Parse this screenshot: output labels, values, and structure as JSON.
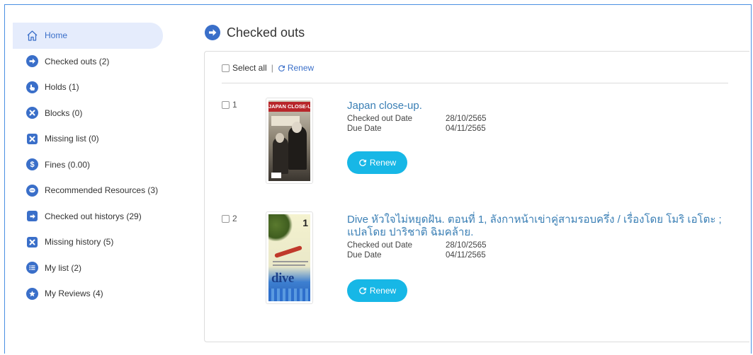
{
  "sidebar": {
    "items": [
      {
        "label": "Home",
        "icon": "home-icon"
      },
      {
        "label": "Checked outs (2)",
        "icon": "arrow-right-circle-icon"
      },
      {
        "label": "Holds (1)",
        "icon": "hand-pointer-icon"
      },
      {
        "label": "Blocks (0)",
        "icon": "block-x-circle-icon"
      },
      {
        "label": "Missing list (0)",
        "icon": "missing-x-square-icon"
      },
      {
        "label": "Fines (0.00)",
        "icon": "dollar-circle-icon"
      },
      {
        "label": "Recommended Resources (3)",
        "icon": "chat-bubble-icon"
      },
      {
        "label": "Checked out historys (29)",
        "icon": "sign-out-square-icon"
      },
      {
        "label": "Missing history (5)",
        "icon": "missing-history-x-square-icon"
      },
      {
        "label": "My list (2)",
        "icon": "list-icon"
      },
      {
        "label": "My Reviews (4)",
        "icon": "star-circle-icon"
      }
    ]
  },
  "page": {
    "title": "Checked outs",
    "select_all_label": "Select all",
    "separator": "|",
    "renew_link_label": "Renew"
  },
  "items": [
    {
      "index": "1",
      "title": "Japan close-up.",
      "checked_out_label": "Checked out Date",
      "checked_out_date": "28/10/2565",
      "due_label": "Due Date",
      "due_date": "04/11/2565",
      "renew_label": "Renew",
      "cover_text": "JAPAN CLOSE-UP"
    },
    {
      "index": "2",
      "title": "Dive หัวใจไม่หยุดฝัน. ตอนที่ 1, ลังกาหน้าเข่าคู่สามรอบครึ่ง / เรื่องโดย โมริ เอโตะ ; แปลโดย ปาริชาติ ฉิมคล้าย.",
      "checked_out_label": "Checked out Date",
      "checked_out_date": "28/10/2565",
      "due_label": "Due Date",
      "due_date": "04/11/2565",
      "renew_label": "Renew",
      "cover_text": "dive"
    }
  ],
  "colors": {
    "accent": "#3a6fc9",
    "active_bg": "#e5ecfc",
    "link": "#3a7fb5",
    "renew_button": "#17b7e6",
    "frame_border": "#4a90e2"
  }
}
